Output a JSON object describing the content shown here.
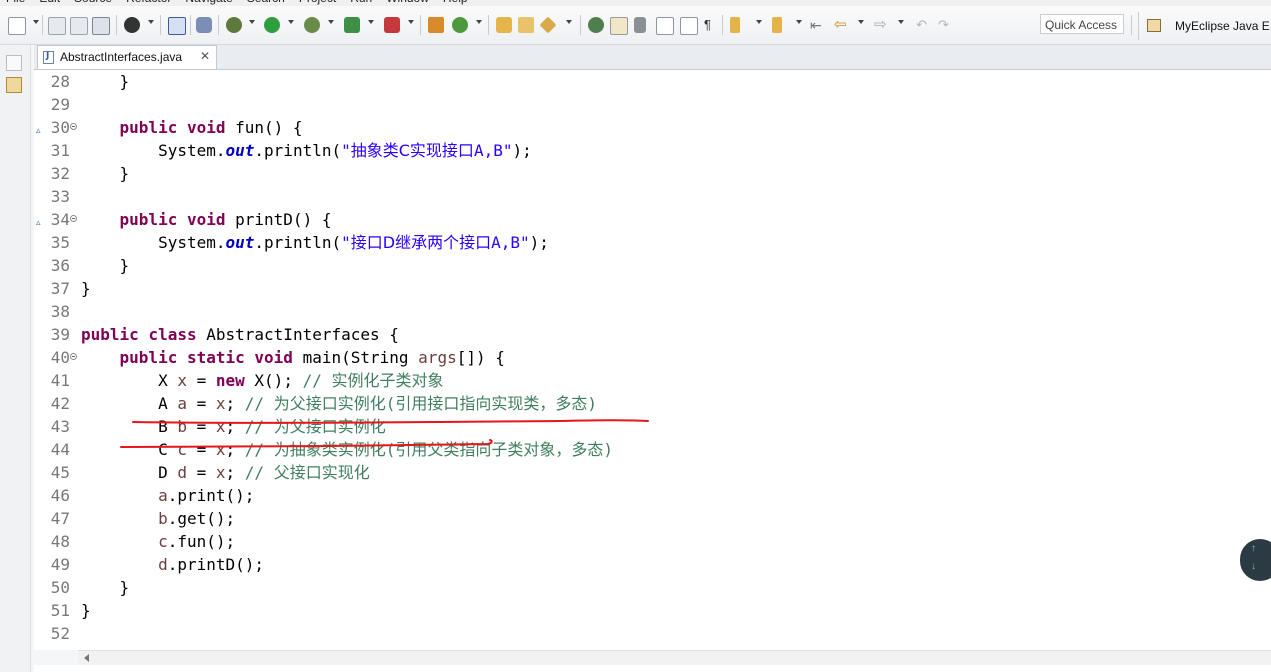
{
  "menu": {
    "items": [
      "File",
      "Edit",
      "Source",
      "Refactor",
      "Navigate",
      "Search",
      "Project",
      "Run",
      "Window",
      "Help"
    ]
  },
  "toolbar": {
    "quick_access_label": "Quick Access",
    "perspective_label": "MyEclipse Java E"
  },
  "editor": {
    "tab_title": "AbstractInterfaces.java",
    "tab_close": "✕",
    "lines": [
      {
        "num": "28",
        "html": "    }"
      },
      {
        "num": "29",
        "html": ""
      },
      {
        "num": "30",
        "html": "    <span class=\"kw\">public</span> <span class=\"kw\">void</span> fun() {",
        "fold": true,
        "override": true
      },
      {
        "num": "31",
        "html": "        System.<span class=\"st\">out</span>.println(<span class=\"str\">\"<span class=\"cn\">抽象类C实现接口</span>A,B\"</span>);"
      },
      {
        "num": "32",
        "html": "    }"
      },
      {
        "num": "33",
        "html": ""
      },
      {
        "num": "34",
        "html": "    <span class=\"kw\">public</span> <span class=\"kw\">void</span> printD() {",
        "fold": true,
        "override": true
      },
      {
        "num": "35",
        "html": "        System.<span class=\"st\">out</span>.println(<span class=\"str\">\"<span class=\"cn\">接口D继承两个接口</span>A,B\"</span>);"
      },
      {
        "num": "36",
        "html": "    }"
      },
      {
        "num": "37",
        "html": "}"
      },
      {
        "num": "38",
        "html": ""
      },
      {
        "num": "39",
        "html": "<span class=\"kw\">public</span> <span class=\"kw\">class</span> AbstractInterfaces {"
      },
      {
        "num": "40",
        "html": "    <span class=\"kw\">public</span> <span class=\"kw\">static</span> <span class=\"kw\">void</span> main(String <span class=\"var\">args</span>[]) {",
        "fold": true
      },
      {
        "num": "41",
        "html": "        X <span class=\"var\">x</span> = <span class=\"kw\">new</span> X(); <span class=\"cm\">// <span class=\"cn\">实例化子类对象</span></span>"
      },
      {
        "num": "42",
        "html": "        A <span class=\"var\">a</span> = <span class=\"var\">x</span>; <span class=\"cm\">// <span class=\"cn\">为父接口实例化</span>(<span class=\"cn\">引用接口指向实现类，多态</span>)</span>"
      },
      {
        "num": "43",
        "html": "        B <span class=\"var\">b</span> = <span class=\"var\">x</span>; <span class=\"cm\">// <span class=\"cn\">为父接口实例化</span></span>"
      },
      {
        "num": "44",
        "html": "        C <span class=\"var\">c</span> = <span class=\"var\">x</span>; <span class=\"cm\">// <span class=\"cn\">为抽象类实例化</span>(<span class=\"cn\">引用父类指向子类对象，多态</span>)</span>"
      },
      {
        "num": "45",
        "html": "        D <span class=\"var\">d</span> = <span class=\"var\">x</span>; <span class=\"cm\">// <span class=\"cn\">父接口实现化</span></span>"
      },
      {
        "num": "46",
        "html": "        <span class=\"var\">a</span>.print();"
      },
      {
        "num": "47",
        "html": "        <span class=\"var\">b</span>.get();"
      },
      {
        "num": "48",
        "html": "        <span class=\"var\">c</span>.fun();"
      },
      {
        "num": "49",
        "html": "        <span class=\"var\">d</span>.printD();"
      },
      {
        "num": "50",
        "html": "    }"
      },
      {
        "num": "51",
        "html": "}"
      },
      {
        "num": "52",
        "html": ""
      }
    ]
  },
  "colors": {
    "keyword": "#7f0055",
    "string": "#2a00ff",
    "comment": "#3f7f5f",
    "annotation_red": "#e8161b"
  }
}
